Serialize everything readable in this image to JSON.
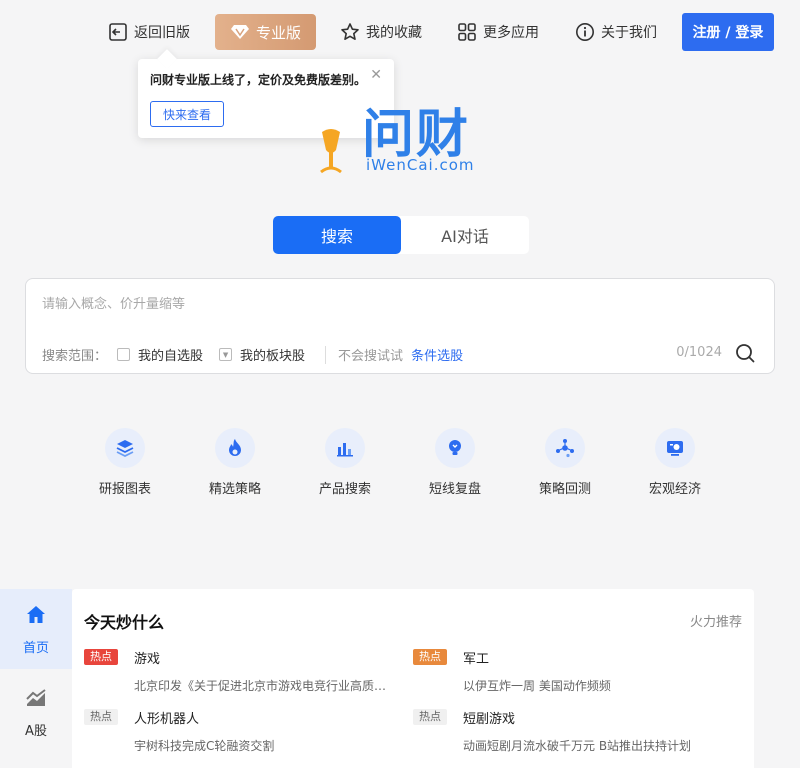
{
  "nav": {
    "back_label": "返回旧版",
    "pro_label": "专业版",
    "fav_label": "我的收藏",
    "more_label": "更多应用",
    "about_label": "关于我们",
    "login_label": "注册 / 登录"
  },
  "popover": {
    "text": "问财专业版上线了，定价及免费版差别。",
    "button": "快来查看",
    "close": "✕"
  },
  "logo": {
    "cn": "问财",
    "en": "iWenCai.com"
  },
  "tabs": [
    {
      "label": "搜索",
      "active": true
    },
    {
      "label": "AI对话",
      "active": false
    }
  ],
  "search": {
    "placeholder": "请输入概念、价升量缩等",
    "scope_label": "搜索范围：",
    "opt_watchlist": "我的自选股",
    "opt_sector": "我的板块股",
    "hint": "不会搜试试",
    "cond_link": "条件选股",
    "counter": "0/1024"
  },
  "features": [
    {
      "label": "研报图表",
      "icon": "layers-icon"
    },
    {
      "label": "精选策略",
      "icon": "flame-icon"
    },
    {
      "label": "产品搜索",
      "icon": "bar-chart-icon"
    },
    {
      "label": "短线复盘",
      "icon": "bulb-icon"
    },
    {
      "label": "策略回测",
      "icon": "network-icon"
    },
    {
      "label": "宏观经济",
      "icon": "monitor-icon"
    }
  ],
  "sidebar": {
    "items": [
      {
        "label": "首页",
        "icon": "home-icon",
        "active": true
      },
      {
        "label": "A股",
        "icon": "stock-chart-icon",
        "active": false
      }
    ]
  },
  "hot": {
    "title": "今天炒什么",
    "rec_label": "火力推荐",
    "items": [
      {
        "badge": "热点",
        "badge_color": "#e8453c",
        "name": "游戏",
        "desc": "北京印发《关于促进北京市游戏电竞行业高质量发展的若干措施》"
      },
      {
        "badge": "热点",
        "badge_color": "#e8893c",
        "name": "军工",
        "desc": "以伊互炸一周 美国动作频频"
      },
      {
        "badge": "热点",
        "badge_color": "#f0f0f0",
        "name": "人形机器人",
        "desc": "宇树科技完成C轮融资交割"
      },
      {
        "badge": "热点",
        "badge_color": "#f0f0f0",
        "name": "短剧游戏",
        "desc": "动画短剧月流水破千万元 B站推出扶持计划"
      }
    ]
  },
  "colors": {
    "accent": "#1a6df5",
    "login_bg": "#2d6cf0",
    "pro_gradient_start": "#e3b18c",
    "logo_blue": "#2f80e8"
  }
}
